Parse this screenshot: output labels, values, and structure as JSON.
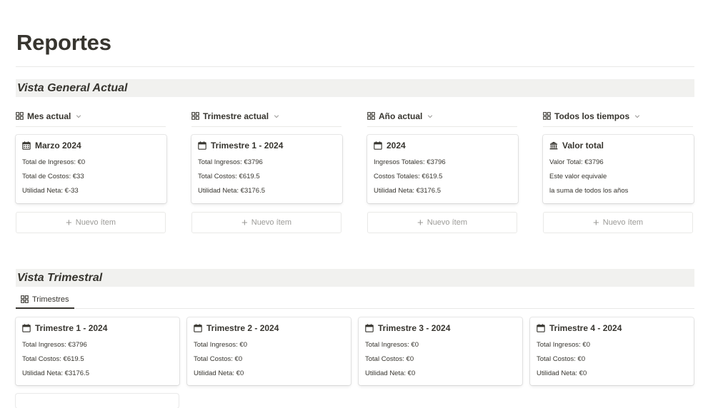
{
  "page": {
    "title": "Reportes"
  },
  "sections": {
    "general": {
      "heading": "Vista General Actual",
      "views": [
        {
          "label": "Mes actual",
          "card": {
            "icon": "calendar-grid-icon",
            "title": "Marzo 2024",
            "lines": [
              "Total de Ingresos: €0",
              "Total de Costos: €33",
              "Utilidad Neta: €-33"
            ]
          },
          "new_item": "Nuevo ítem"
        },
        {
          "label": "Trimestre actual",
          "card": {
            "icon": "calendar-icon",
            "title": "Trimestre 1 - 2024",
            "lines": [
              "Total Ingresos: €3796",
              "Total Costos: €619.5",
              "Utilidad Neta: €3176.5"
            ]
          },
          "new_item": "Nuevo ítem"
        },
        {
          "label": "Año actual",
          "card": {
            "icon": "calendar-icon",
            "title": "2024",
            "lines": [
              "Ingresos Totales: €3796",
              "Costos Totales: €619.5",
              "Utilidad Neta: €3176.5"
            ]
          },
          "new_item": "Nuevo ítem"
        },
        {
          "label": "Todos los tiempos",
          "card": {
            "icon": "bank-icon",
            "title": "Valor total",
            "lines": [
              "Valor Total: €3796",
              "Este valor equivale",
              "la suma de todos los años"
            ]
          },
          "new_item": "Nuevo ítem"
        }
      ]
    },
    "quarterly": {
      "heading": "Vista Trimestral",
      "tab": "Trimestres",
      "cards": [
        {
          "title": "Trimestre 1 - 2024",
          "lines": [
            "Total Ingresos: €3796",
            "Total Costos: €619.5",
            "Utilidad Neta: €3176.5"
          ]
        },
        {
          "title": "Trimestre 2 - 2024",
          "lines": [
            "Total Ingresos: €0",
            "Total Costos: €0",
            "Utilidad Neta: €0"
          ]
        },
        {
          "title": "Trimestre 3 - 2024",
          "lines": [
            "Total Ingresos: €0",
            "Total Costos: €0",
            "Utilidad Neta: €0"
          ]
        },
        {
          "title": "Trimestre 4 - 2024",
          "lines": [
            "Total Ingresos: €0",
            "Total Costos: €0",
            "Utilidad Neta: €0"
          ]
        }
      ]
    }
  },
  "colors": {
    "text": "#37352f",
    "muted": "#9b9a97",
    "heading_bg": "#f1f1ef",
    "divider": "#e9e9e7"
  }
}
